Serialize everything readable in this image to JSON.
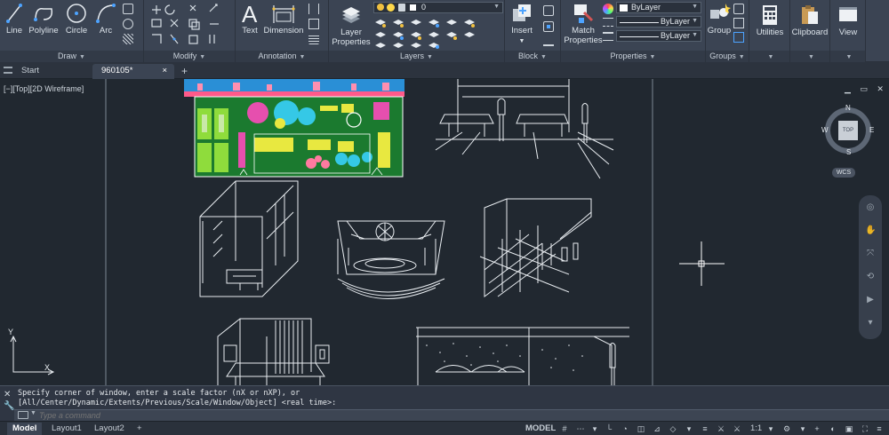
{
  "ribbon": {
    "draw": {
      "title": "Draw",
      "line": "Line",
      "polyline": "Polyline",
      "circle": "Circle",
      "arc": "Arc"
    },
    "modify": {
      "title": "Modify"
    },
    "annotation": {
      "title": "Annotation",
      "text": "Text",
      "dimension": "Dimension"
    },
    "layers": {
      "title": "Layers",
      "layer_properties_1": "Layer",
      "layer_properties_2": "Properties",
      "current_layer": "0"
    },
    "block": {
      "title": "Block",
      "insert": "Insert"
    },
    "properties": {
      "title": "Properties",
      "match_1": "Match",
      "match_2": "Properties",
      "color": "ByLayer",
      "linetype": "ByLayer",
      "lineweight": "ByLayer"
    },
    "groups": {
      "title": "Groups",
      "group": "Group"
    },
    "utilities": {
      "label": "Utilities"
    },
    "clipboard": {
      "label": "Clipboard"
    },
    "view": {
      "label": "View"
    }
  },
  "tabs": {
    "start": "Start",
    "drawing": "960105*",
    "close": "×",
    "add": "+"
  },
  "viewport": {
    "label": "[−][Top][2D Wireframe]",
    "viewcube": {
      "n": "N",
      "s": "S",
      "e": "E",
      "w": "W",
      "face": "TOP",
      "wcs": "WCS"
    },
    "ucs": {
      "x": "X",
      "y": "Y"
    }
  },
  "command": {
    "line1": "Specify corner of window, enter a scale factor (nX or nXP), or",
    "line2": "[All/Center/Dynamic/Extents/Previous/Scale/Window/Object] <real time>:",
    "placeholder": "Type a command"
  },
  "status": {
    "model": "Model",
    "layout1": "Layout1",
    "layout2": "Layout2",
    "add": "+",
    "space": "MODEL",
    "scale": "1:1"
  },
  "colors": {
    "ribbon": "#3b4453",
    "canvas": "#212830",
    "accent": "#4da3ff"
  }
}
